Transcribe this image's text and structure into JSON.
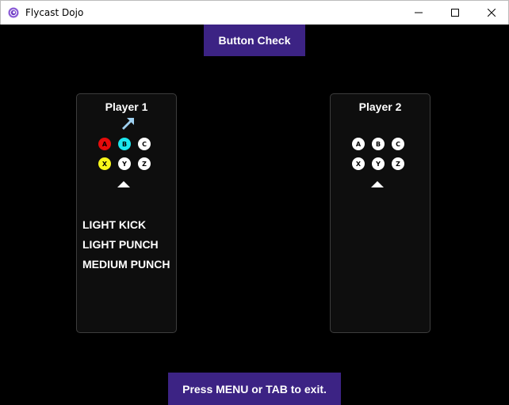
{
  "window": {
    "title": "Flycast Dojo"
  },
  "header": {
    "button_check_label": "Button Check"
  },
  "player1": {
    "title": "Player 1",
    "direction": "up-right",
    "buttons": [
      {
        "label": "A",
        "pressed": true,
        "color": "#e60b0b"
      },
      {
        "label": "B",
        "pressed": true,
        "color": "#1ce6ee"
      },
      {
        "label": "C",
        "pressed": false,
        "color": "#ffffff"
      },
      {
        "label": "X",
        "pressed": true,
        "color": "#f7f71a"
      },
      {
        "label": "Y",
        "pressed": false,
        "color": "#ffffff"
      },
      {
        "label": "Z",
        "pressed": false,
        "color": "#ffffff"
      }
    ],
    "actions": [
      "LIGHT KICK",
      "LIGHT PUNCH",
      "MEDIUM PUNCH"
    ]
  },
  "player2": {
    "title": "Player 2",
    "buttons": [
      {
        "label": "A",
        "pressed": false,
        "color": "#ffffff"
      },
      {
        "label": "B",
        "pressed": false,
        "color": "#ffffff"
      },
      {
        "label": "C",
        "pressed": false,
        "color": "#ffffff"
      },
      {
        "label": "X",
        "pressed": false,
        "color": "#ffffff"
      },
      {
        "label": "Y",
        "pressed": false,
        "color": "#ffffff"
      },
      {
        "label": "Z",
        "pressed": false,
        "color": "#ffffff"
      }
    ]
  },
  "footer": {
    "exit_hint": "Press MENU or TAB to exit."
  },
  "colors": {
    "accent": "#3c2384",
    "panel_bg": "#0e0e0e",
    "arrow": "#9fd0f0"
  }
}
